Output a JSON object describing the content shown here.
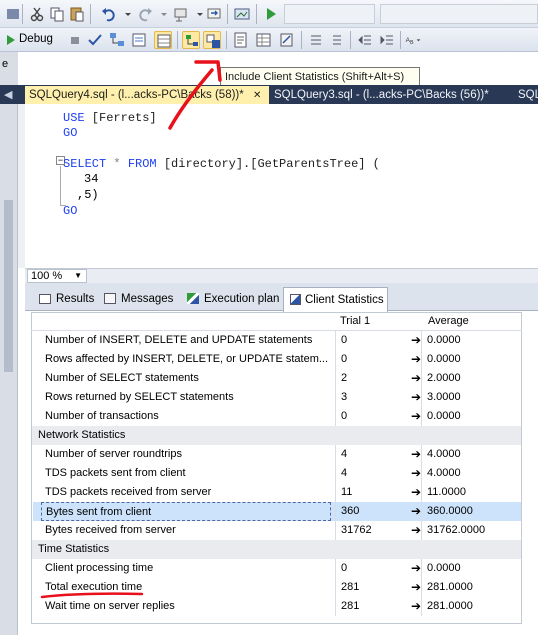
{
  "toolbar2": {
    "debug_label": "Debug"
  },
  "tooltip": "Include Client Statistics (Shift+Alt+S)",
  "tabs": [
    {
      "label": "SQLQuery4.sql - (l...acks-PC\\Backs (58))*",
      "close": "✕"
    },
    {
      "label": "SQLQuery3.sql - (l...acks-PC\\Backs (56))*"
    },
    {
      "label": "SQL"
    }
  ],
  "code": {
    "line1_kw": "USE",
    "line1_rest": " [Ferrets]",
    "line2": "GO",
    "line4_kw1": "SELECT",
    "line4_star": " * ",
    "line4_kw2": "FROM",
    "line4_rest": " [directory].[GetParentsTree] (",
    "line5": "34",
    "line6": ",5)",
    "line7": "GO"
  },
  "zoom": "100 %",
  "result_tabs": [
    "Results",
    "Messages",
    "Execution plan",
    "Client Statistics"
  ],
  "grid": {
    "headers": {
      "trial": "Trial  1",
      "average": "Average"
    },
    "arrow": "➔",
    "rows": [
      {
        "label": "Number of INSERT, DELETE and UPDATE statements",
        "trial": "0",
        "average": "0.0000"
      },
      {
        "label": "Rows affected by INSERT, DELETE, or UPDATE statem...",
        "trial": "0",
        "average": "0.0000"
      },
      {
        "label": "Number of SELECT statements",
        "trial": "2",
        "average": "2.0000"
      },
      {
        "label": "Rows returned by SELECT statements",
        "trial": "3",
        "average": "3.0000"
      },
      {
        "label": "Number of transactions",
        "trial": "0",
        "average": "0.0000"
      }
    ],
    "section2": "Network Statistics",
    "rows2": [
      {
        "label": "Number of server roundtrips",
        "trial": "4",
        "average": "4.0000"
      },
      {
        "label": "TDS packets sent from client",
        "trial": "4",
        "average": "4.0000"
      },
      {
        "label": "TDS packets received from server",
        "trial": "11",
        "average": "11.0000"
      },
      {
        "label": "Bytes sent from client",
        "trial": "360",
        "average": "360.0000"
      },
      {
        "label": "Bytes received from server",
        "trial": "31762",
        "average": "31762.0000"
      }
    ],
    "section3": "Time Statistics",
    "rows3": [
      {
        "label": "Client processing time",
        "trial": "0",
        "average": "0.0000"
      },
      {
        "label": "Total execution time",
        "trial": "281",
        "average": "281.0000"
      },
      {
        "label": "Wait time on server replies",
        "trial": "281",
        "average": "281.0000"
      }
    ]
  },
  "colors": {
    "annotation": "#e8101a",
    "tab_active": "#fff1ad",
    "title_bar": "#293955",
    "selection": "#cce3fb"
  }
}
